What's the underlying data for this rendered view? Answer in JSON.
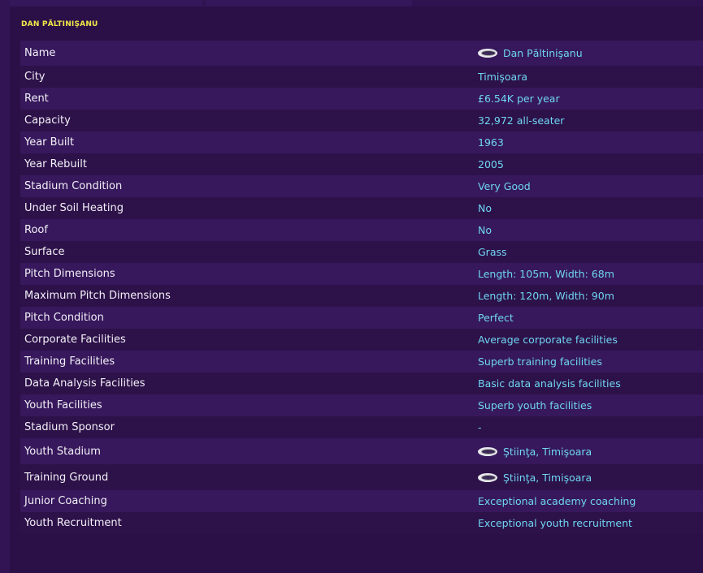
{
  "section": {
    "title": "DAN PĂLTINIŞANU"
  },
  "rows": [
    {
      "label": "Name",
      "value": "Dan Păltinişanu",
      "icon": "stadium-icon",
      "link": true
    },
    {
      "label": "City",
      "value": "Timişoara",
      "link": true
    },
    {
      "label": "Rent",
      "value": "£6.54K per year"
    },
    {
      "label": "Capacity",
      "value": "32,972 all-seater"
    },
    {
      "label": "Year Built",
      "value": "1963"
    },
    {
      "label": "Year Rebuilt",
      "value": "2005"
    },
    {
      "label": "Stadium Condition",
      "value": "Very Good"
    },
    {
      "label": "Under Soil Heating",
      "value": "No"
    },
    {
      "label": "Roof",
      "value": "No"
    },
    {
      "label": "Surface",
      "value": "Grass"
    },
    {
      "label": "Pitch Dimensions",
      "value": "Length: 105m, Width: 68m"
    },
    {
      "label": "Maximum Pitch Dimensions",
      "value": "Length: 120m, Width: 90m"
    },
    {
      "label": "Pitch Condition",
      "value": "Perfect"
    },
    {
      "label": "Corporate Facilities",
      "value": "Average corporate facilities"
    },
    {
      "label": "Training Facilities",
      "value": "Superb training facilities"
    },
    {
      "label": "Data Analysis Facilities",
      "value": "Basic data analysis facilities"
    },
    {
      "label": "Youth Facilities",
      "value": "Superb youth facilities"
    },
    {
      "label": "Stadium Sponsor",
      "value": "-"
    },
    {
      "label": "Youth Stadium",
      "value": "Ştiinţa, Timişoara",
      "icon": "stadium-icon",
      "link": true
    },
    {
      "label": "Training Ground",
      "value": "Ştiinţa, Timişoara",
      "icon": "stadium-icon",
      "link": true
    },
    {
      "label": "Junior Coaching",
      "value": "Exceptional academy coaching"
    },
    {
      "label": "Youth Recruitment",
      "value": "Exceptional youth recruitment"
    }
  ],
  "colors": {
    "background": "#2a1047",
    "row_odd": "#37185c",
    "row_even": "#2d1149",
    "title": "#f2e84a",
    "label": "#f2f0f7",
    "value": "#6fd6f2"
  }
}
